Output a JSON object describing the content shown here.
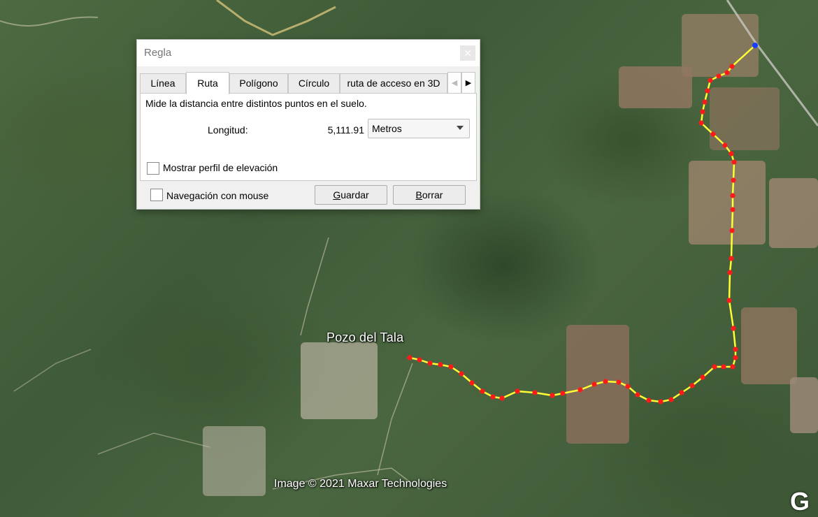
{
  "map": {
    "place_label": "Pozo del Tala",
    "attribution": "Image © 2021 Maxar Technologies",
    "logo": "G"
  },
  "dialog": {
    "title": "Regla",
    "close_icon": "close-icon",
    "tabs": [
      {
        "label": "Línea",
        "active": false
      },
      {
        "label": "Ruta",
        "active": true
      },
      {
        "label": "Polígono",
        "active": false
      },
      {
        "label": "Círculo",
        "active": false
      },
      {
        "label": "ruta de acceso en 3D",
        "active": false
      }
    ],
    "description": "Mide la distancia entre distintos puntos en el suelo.",
    "length_label": "Longitud:",
    "length_value": "5,111.91",
    "unit": "Metros",
    "elevation_profile_label": "Mostrar perfil de elevación",
    "mouse_nav_label": "Navegación con mouse",
    "save_first": "G",
    "save_rest": "uardar",
    "clear_first": "B",
    "clear_rest": "orrar"
  },
  "colors": {
    "route_line": "#ffff33",
    "route_points": "#ff1a1a",
    "end_point": "#1a3cff"
  }
}
